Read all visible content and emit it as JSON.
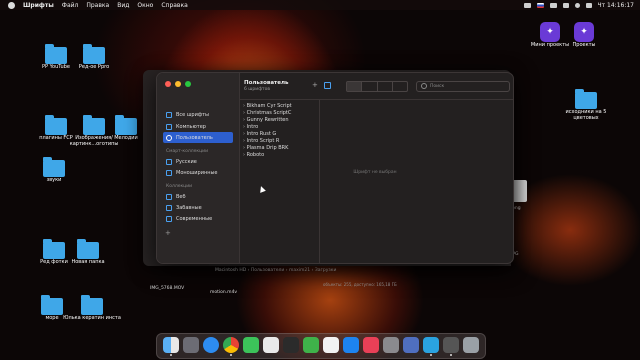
{
  "menubar": {
    "app": "Шрифты",
    "items": [
      "Файл",
      "Правка",
      "Вид",
      "Окно",
      "Справка"
    ],
    "clock": "Чт 14:16:17"
  },
  "desktop": {
    "icons": [
      {
        "label": "PP YouTube"
      },
      {
        "label": "Ред-ое Ppro"
      },
      {
        "label": "плагины FCP"
      },
      {
        "label": "Изображения/ картинк...оготипы"
      },
      {
        "label": "Мелодии"
      },
      {
        "label": "звуки"
      },
      {
        "label": "Ред фотки"
      },
      {
        "label": "Новая папка"
      },
      {
        "label": "море"
      },
      {
        "label": "Юлька кератин инста"
      },
      {
        "label": "исходники на 5 цветовых"
      },
      {
        "label": "Мини проекты"
      },
      {
        "label": "Проекты"
      }
    ],
    "files": {
      "left_file": "IMG_5768.MOV",
      "bottom_file": "motion.m4v",
      "right_peek": "png",
      "right_file": "JPG"
    }
  },
  "finder_back": {
    "path": [
      "Macintosh HD",
      "Пользователи",
      "maxim21",
      "Загрузки"
    ],
    "status": "объекты: 255, доступно: 165,18 ГБ",
    "thumb_text": [
      "Яц",
      "ЯЦ"
    ]
  },
  "fontbook": {
    "sidebar": {
      "top_items": [
        "Все шрифты",
        "Компьютер",
        "Пользователь"
      ],
      "smart_header": "Смарт-коллекции",
      "smart_items": [
        "Русские",
        "Моноширинные"
      ],
      "coll_header": "Коллекции",
      "coll_items": [
        "Веб",
        "Забавные",
        "Современные"
      ],
      "add": "+"
    },
    "toolbar": {
      "title": "Пользователь",
      "subtitle": "6 шрифтов",
      "add": "+",
      "search_placeholder": "Поиск"
    },
    "fonts": [
      "Bikham Cyr Script",
      "Christmas ScriptC",
      "Gunny Rewritten",
      "Intro",
      "Intro Rust G",
      "Intro Script R",
      "Plasma Drip BRK",
      "Roboto"
    ],
    "preview_empty": "Шрифт не выбран"
  },
  "colors": {
    "accent": "#2d5fcf",
    "folder": "#3fa7e8",
    "traffic": [
      "#ff5f57",
      "#febc2e",
      "#28c840"
    ]
  }
}
